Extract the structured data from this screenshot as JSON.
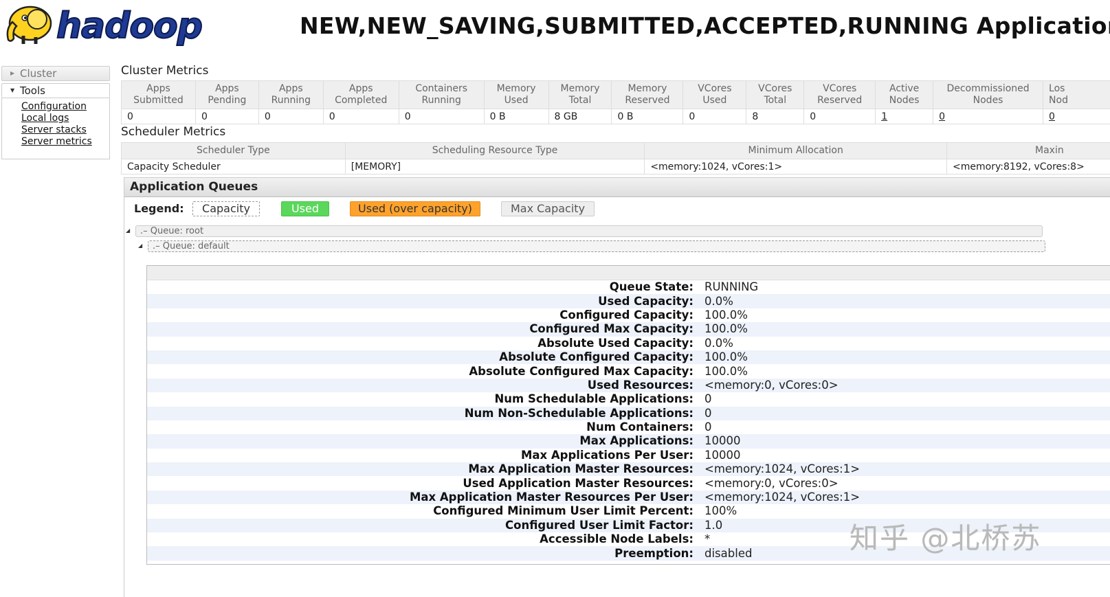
{
  "header": {
    "logo_text": "hadoop",
    "title": "NEW,NEW_SAVING,SUBMITTED,ACCEPTED,RUNNING Applications"
  },
  "sidebar": {
    "cluster_label": "Cluster",
    "tools_label": "Tools",
    "tools_links": [
      "Configuration",
      "Local logs",
      "Server stacks",
      "Server metrics"
    ]
  },
  "cluster_metrics": {
    "title": "Cluster Metrics",
    "headers": [
      [
        "Apps",
        "Submitted"
      ],
      [
        "Apps",
        "Pending"
      ],
      [
        "Apps",
        "Running"
      ],
      [
        "Apps",
        "Completed"
      ],
      [
        "Containers",
        "Running"
      ],
      [
        "Memory",
        "Used"
      ],
      [
        "Memory",
        "Total"
      ],
      [
        "Memory",
        "Reserved"
      ],
      [
        "VCores",
        "Used"
      ],
      [
        "VCores",
        "Total"
      ],
      [
        "VCores",
        "Reserved"
      ],
      [
        "Active",
        "Nodes"
      ],
      [
        "Decommissioned",
        "Nodes"
      ],
      [
        "Los",
        "Nod"
      ]
    ],
    "values": [
      "0",
      "0",
      "0",
      "0",
      "0",
      "0 B",
      "8 GB",
      "0 B",
      "0",
      "8",
      "0",
      "1",
      "0",
      "0"
    ]
  },
  "scheduler_metrics": {
    "title": "Scheduler Metrics",
    "headers": [
      "Scheduler Type",
      "Scheduling Resource Type",
      "Minimum Allocation",
      "Maxin"
    ],
    "values": [
      "Capacity Scheduler",
      "[MEMORY]",
      "<memory:1024, vCores:1>",
      "<memory:8192, vCores:8>"
    ]
  },
  "app_queues": {
    "title": "Application Queues",
    "legend": {
      "label": "Legend:",
      "capacity": "Capacity",
      "used": "Used",
      "over": "Used (over capacity)",
      "max": "Max Capacity"
    },
    "queues": [
      ".– Queue: root",
      ".– Queue: default"
    ],
    "details": [
      [
        "Queue State:",
        "RUNNING"
      ],
      [
        "Used Capacity:",
        "0.0%"
      ],
      [
        "Configured Capacity:",
        "100.0%"
      ],
      [
        "Configured Max Capacity:",
        "100.0%"
      ],
      [
        "Absolute Used Capacity:",
        "0.0%"
      ],
      [
        "Absolute Configured Capacity:",
        "100.0%"
      ],
      [
        "Absolute Configured Max Capacity:",
        "100.0%"
      ],
      [
        "Used Resources:",
        "<memory:0, vCores:0>"
      ],
      [
        "Num Schedulable Applications:",
        "0"
      ],
      [
        "Num Non-Schedulable Applications:",
        "0"
      ],
      [
        "Num Containers:",
        "0"
      ],
      [
        "Max Applications:",
        "10000"
      ],
      [
        "Max Applications Per User:",
        "10000"
      ],
      [
        "Max Application Master Resources:",
        "<memory:1024, vCores:1>"
      ],
      [
        "Used Application Master Resources:",
        "<memory:0, vCores:0>"
      ],
      [
        "Max Application Master Resources Per User:",
        "<memory:1024, vCores:1>"
      ],
      [
        "Configured Minimum User Limit Percent:",
        "100%"
      ],
      [
        "Configured User Limit Factor:",
        "1.0"
      ],
      [
        "Accessible Node Labels:",
        "*"
      ],
      [
        "Preemption:",
        "disabled"
      ]
    ]
  },
  "watermark": "知乎 @北桥苏",
  "colors": {
    "used": "#5bd75b",
    "over_capacity": "#ffa22c",
    "max_capacity": "#eeeeee",
    "row_alt": "#edf2fb"
  }
}
